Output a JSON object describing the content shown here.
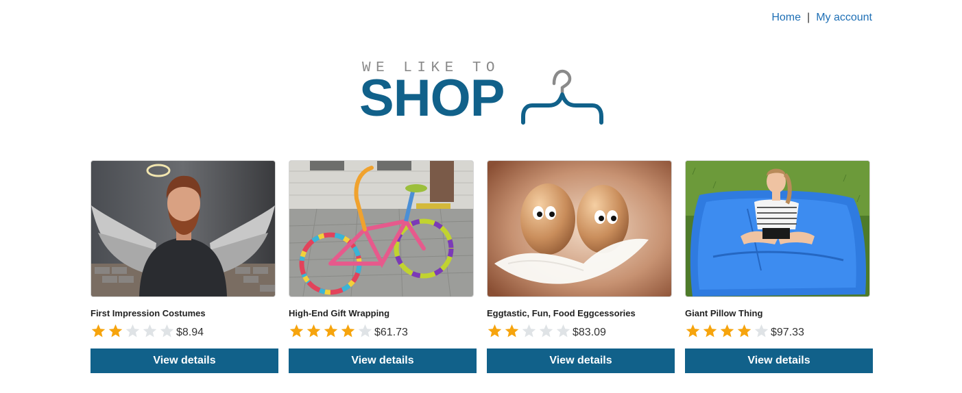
{
  "nav": {
    "home": "Home",
    "separator": "|",
    "account": "My account",
    "link_color": "#1e6fb5"
  },
  "logo": {
    "tagline": "WE LIKE TO",
    "brand": "SHOP",
    "icon": "hanger-icon",
    "brand_color": "#11618a"
  },
  "colors": {
    "accent": "#11618a",
    "star_filled": "#f6a40d",
    "star_empty": "#dfe3e6"
  },
  "products": [
    {
      "name": "First Impression Costumes",
      "rating": 2,
      "rating_max": 5,
      "price": "$8.94",
      "button": "View details",
      "image": "angel-costume-man-image"
    },
    {
      "name": "High-End Gift Wrapping",
      "rating": 4,
      "rating_max": 5,
      "price": "$61.73",
      "button": "View details",
      "image": "yarn-wrapped-bicycle-image"
    },
    {
      "name": "Eggtastic, Fun, Food Eggcessories",
      "rating": 2,
      "rating_max": 5,
      "price": "$83.09",
      "button": "View details",
      "image": "googly-eye-eggs-image"
    },
    {
      "name": "Giant Pillow Thing",
      "rating": 4,
      "rating_max": 5,
      "price": "$97.33",
      "button": "View details",
      "image": "giant-blue-pillow-image"
    }
  ]
}
